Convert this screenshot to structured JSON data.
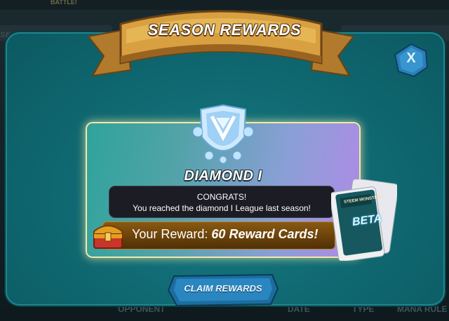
{
  "background": {
    "battle_label": "BATTLE!",
    "season_label": "SEASON RE",
    "footer_columns": [
      "OPPONENT",
      "DATE",
      "TYPE",
      "MANA RULE"
    ]
  },
  "modal": {
    "title": "SEASON REWARDS",
    "close_label": "X",
    "league_name": "DIAMOND I",
    "congrats_title": "CONGRATS!",
    "congrats_text": "You reached the diamond I League last season!",
    "reward_prefix": "Your Reward:",
    "reward_value": "60 Reward Cards!",
    "claim_label": "CLAIM REWARDS",
    "pack_label": "BETA",
    "pack_brand": "STEEM MONSTERS"
  },
  "colors": {
    "modal_bg": "#0f6770",
    "panel_glow": "#f1e9a8",
    "ribbon_gold": "#d8a040",
    "reward_bar": "#6a420a"
  },
  "icons": [
    "diamond-league-badge-icon",
    "treasure-chest-icon",
    "card-pack-icon",
    "close-icon"
  ]
}
